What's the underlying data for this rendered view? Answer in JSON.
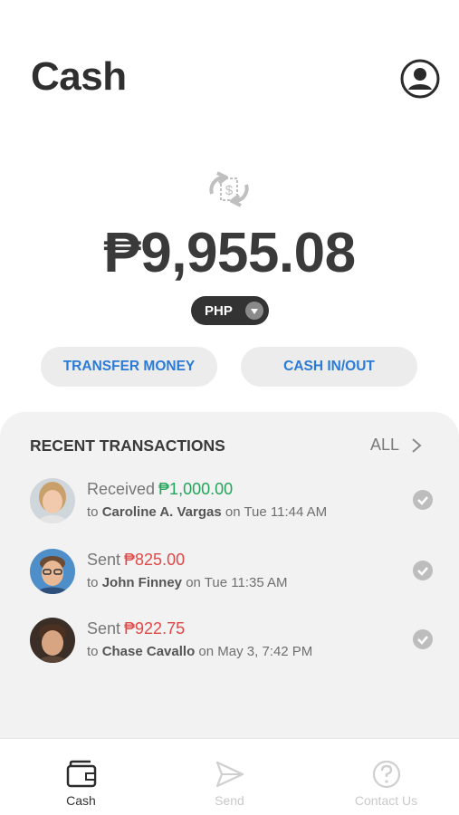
{
  "header": {
    "title": "Cash",
    "profile_icon": "user-circle-icon"
  },
  "balance": {
    "icon": "exchange-dollar-icon",
    "amount": "₱9,955.08",
    "currency": "PHP"
  },
  "actions": {
    "transfer_label": "TRANSFER MONEY",
    "cash_label": "CASH IN/OUT"
  },
  "transactions": {
    "title": "RECENT TRANSACTIONS",
    "all_label": "ALL",
    "items": [
      {
        "type": "Received",
        "amount": "₱1,000.00",
        "to_prefix": "to",
        "name": "Caroline A. Vargas",
        "when": "on Tue 11:44 AM",
        "color": "#22a55a"
      },
      {
        "type": "Sent",
        "amount": "₱825.00",
        "to_prefix": "to",
        "name": "John Finney",
        "when": "on Tue 11:35 AM",
        "color": "#e04848"
      },
      {
        "type": "Sent",
        "amount": "₱922.75",
        "to_prefix": "to",
        "name": "Chase Cavallo",
        "when": "on May 3, 7:42 PM",
        "color": "#e04848"
      }
    ]
  },
  "nav": {
    "items": [
      {
        "label": "Cash",
        "icon": "wallet-icon",
        "active": true
      },
      {
        "label": "Send",
        "icon": "send-icon",
        "active": false
      },
      {
        "label": "Contact Us",
        "icon": "help-icon",
        "active": false
      }
    ]
  },
  "colors": {
    "accent": "#2a7bd6",
    "received": "#22a55a",
    "sent": "#e04848"
  }
}
